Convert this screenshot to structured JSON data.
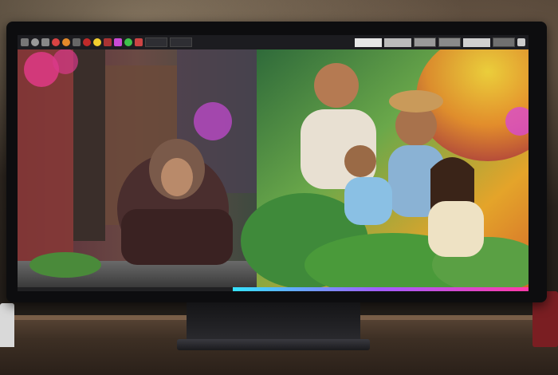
{
  "scene": {
    "toolbar": {
      "icons": [
        "menu-icon",
        "brush-icon",
        "eraser-icon",
        "rect-icon",
        "circle-icon",
        "pen-icon",
        "color-red-icon",
        "color-orange-icon",
        "color-yellow-icon",
        "color-green-icon",
        "layers-icon",
        "settings-icon"
      ],
      "colors": [
        "#d94343",
        "#e58a2a",
        "#f2cf2e",
        "#3ec24b",
        "#3f8ed9",
        "#c94ad6"
      ]
    },
    "artwork": {
      "left_panel": "fantasy-alley-hooded-figure",
      "right_panel": "smiling-family-in-garden"
    },
    "statusbar": {
      "progress_colors": [
        "#35e3ff",
        "#a35cff",
        "#ff3aa8"
      ]
    }
  }
}
